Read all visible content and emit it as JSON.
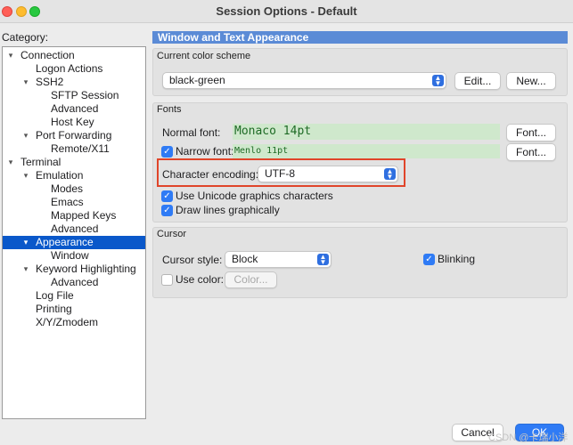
{
  "window": {
    "title": "Session Options - Default"
  },
  "sidebar": {
    "label": "Category:",
    "items": [
      {
        "label": "Connection",
        "level": 0,
        "expanded": true
      },
      {
        "label": "Logon Actions",
        "level": 1
      },
      {
        "label": "SSH2",
        "level": 1,
        "expanded": true
      },
      {
        "label": "SFTP Session",
        "level": 2
      },
      {
        "label": "Advanced",
        "level": 2
      },
      {
        "label": "Host Key",
        "level": 2
      },
      {
        "label": "Port Forwarding",
        "level": 1,
        "expanded": true
      },
      {
        "label": "Remote/X11",
        "level": 2
      },
      {
        "label": "Terminal",
        "level": 0,
        "expanded": true
      },
      {
        "label": "Emulation",
        "level": 1,
        "expanded": true
      },
      {
        "label": "Modes",
        "level": 2
      },
      {
        "label": "Emacs",
        "level": 2
      },
      {
        "label": "Mapped Keys",
        "level": 2
      },
      {
        "label": "Advanced",
        "level": 2
      },
      {
        "label": "Appearance",
        "level": 1,
        "expanded": true,
        "selected": true
      },
      {
        "label": "Window",
        "level": 2
      },
      {
        "label": "Keyword Highlighting",
        "level": 1,
        "expanded": true
      },
      {
        "label": "Advanced",
        "level": 2
      },
      {
        "label": "Log File",
        "level": 1
      },
      {
        "label": "Printing",
        "level": 1
      },
      {
        "label": "X/Y/Zmodem",
        "level": 1
      }
    ]
  },
  "main": {
    "header": "Window and Text Appearance",
    "color_scheme": {
      "title": "Current color scheme",
      "value": "black-green",
      "edit_label": "Edit...",
      "new_label": "New..."
    },
    "fonts": {
      "title": "Fonts",
      "normal_label": "Normal font:",
      "normal_value": "Monaco 14pt",
      "narrow_label": "Narrow font:",
      "narrow_value": "Menlo 11pt",
      "narrow_checked": true,
      "font_button_label": "Font...",
      "encoding_label": "Character encoding:",
      "encoding_value": "UTF-8",
      "unicode_label": "Use Unicode graphics characters",
      "unicode_checked": true,
      "lines_label": "Draw lines graphically",
      "lines_checked": true
    },
    "cursor": {
      "title": "Cursor",
      "style_label": "Cursor style:",
      "style_value": "Block",
      "blinking_label": "Blinking",
      "blinking_checked": true,
      "use_color_label": "Use color:",
      "use_color_checked": false,
      "color_button_label": "Color..."
    }
  },
  "footer": {
    "cancel_label": "Cancel",
    "ok_label": "OK"
  },
  "watermark": "CSDN @卡瑞小洋",
  "colors": {
    "accent": "#2f7bf5",
    "selection": "#0a58ca",
    "header": "#5b8bd6",
    "font_field_bg": "#cfe8cc",
    "font_field_text": "#1e6b25",
    "highlight": "#e0452a"
  }
}
